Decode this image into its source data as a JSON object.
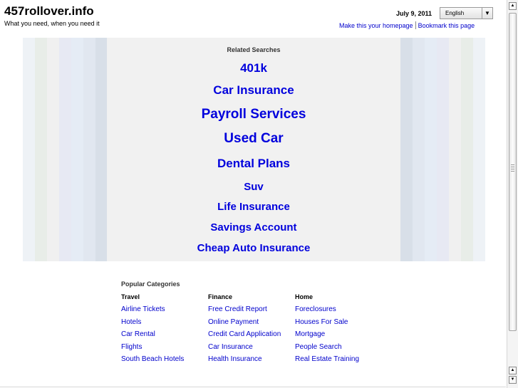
{
  "header": {
    "site_title": "457rollover.info",
    "tagline": "What you need, when you need it",
    "date": "July 9, 2011",
    "language_select": {
      "selected": "English",
      "arrow_icon": "chevron-down-icon"
    },
    "links": {
      "homepage": "Make this your homepage",
      "bookmark": "Bookmark this page"
    }
  },
  "related_searches": {
    "title": "Related Searches",
    "items": [
      {
        "label": "401k"
      },
      {
        "label": "Car Insurance"
      },
      {
        "label": "Payroll Services"
      },
      {
        "label": "Used Car"
      },
      {
        "label": "Dental Plans"
      },
      {
        "label": "Suv"
      },
      {
        "label": "Life Insurance"
      },
      {
        "label": "Savings Account"
      },
      {
        "label": "Cheap Auto Insurance"
      }
    ]
  },
  "stripe_colors": {
    "left": [
      "#eef2f6",
      "#e8ede8",
      "#f0f0f0",
      "#e7e9f3",
      "#e5ecf5",
      "#e1e7f0",
      "#d8dfe8"
    ],
    "right": [
      "#d8dfe8",
      "#e1e7f0",
      "#e5ecf5",
      "#e7e9f3",
      "#f0f0f0",
      "#e8ede8",
      "#eef2f6"
    ]
  },
  "popular_categories": {
    "title": "Popular Categories",
    "columns": [
      {
        "heading": "Travel",
        "links": [
          "Airline Tickets",
          "Hotels",
          "Car Rental",
          "Flights",
          "South Beach Hotels"
        ]
      },
      {
        "heading": "Finance",
        "links": [
          "Free Credit Report",
          "Online Payment",
          "Credit Card Application",
          "Car Insurance",
          "Health Insurance"
        ]
      },
      {
        "heading": "Home",
        "links": [
          "Foreclosures",
          "Houses For Sale",
          "Mortgage",
          "People Search",
          "Real Estate Training"
        ]
      }
    ]
  },
  "scrollbar": {
    "up_icon": "arrow-up-icon",
    "down_icon": "arrow-down-icon"
  }
}
